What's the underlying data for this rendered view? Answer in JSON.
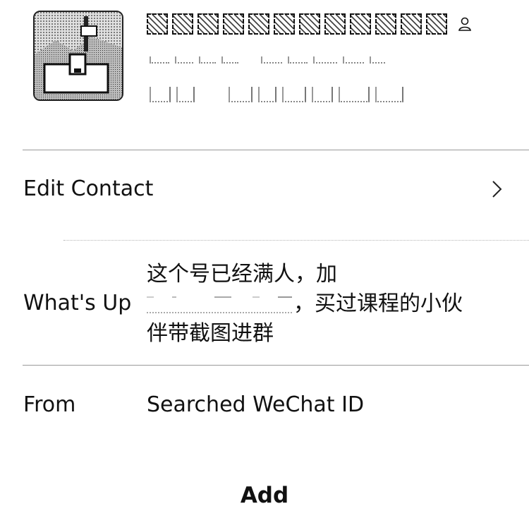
{
  "contact": {
    "name_redacted": true,
    "badge_icon": "person-icon"
  },
  "rows": {
    "edit_contact_label": "Edit Contact",
    "edit_contact_icon": "chevron-right-icon",
    "whats_up_label": "What's Up",
    "whats_up_line1": "这个号已经满人，加",
    "whats_up_line2_suffix": "，买过课程的小伙",
    "whats_up_line3": "伴带截图进群",
    "from_label": "From",
    "from_value": "Searched WeChat ID"
  },
  "actions": {
    "add_label": "Add"
  }
}
